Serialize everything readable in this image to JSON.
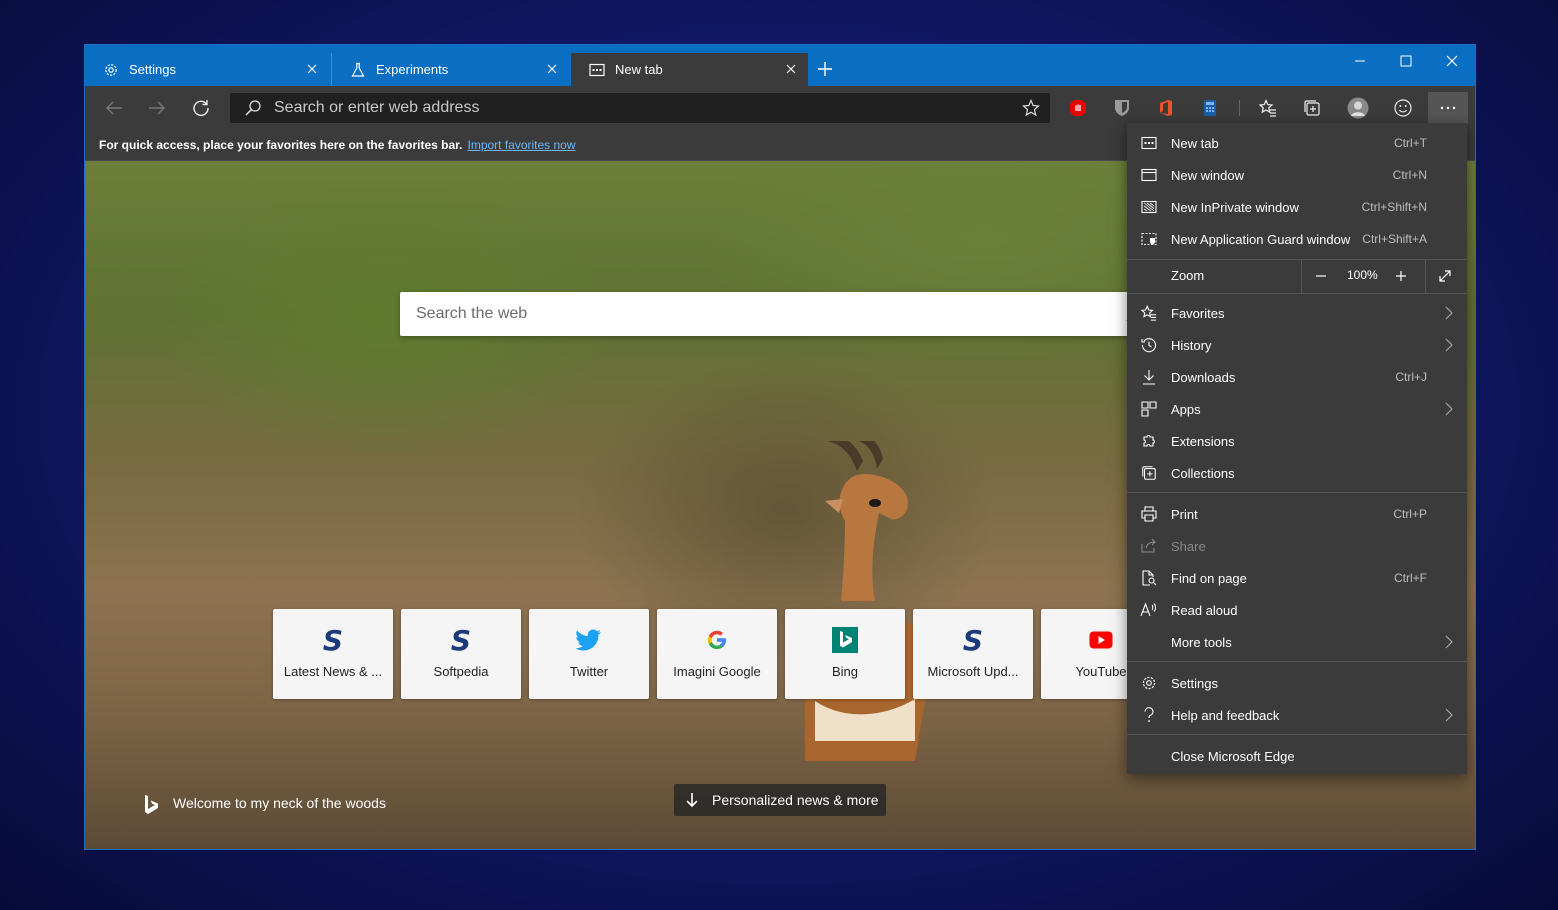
{
  "tabs": [
    {
      "label": "Settings",
      "icon": "gear-icon"
    },
    {
      "label": "Experiments",
      "icon": "flask-icon"
    },
    {
      "label": "New tab",
      "icon": "newtab-icon"
    }
  ],
  "address_bar": {
    "placeholder": "Search or enter web address"
  },
  "favorites_bar": {
    "message": "For quick access, place your favorites here on the favorites bar.",
    "link": "Import favorites now"
  },
  "newtab": {
    "search_placeholder": "Search the web",
    "tiles": [
      {
        "label": "Latest News & ...",
        "logo": "S",
        "color": "#1b3a7a"
      },
      {
        "label": "Softpedia",
        "logo": "S",
        "color": "#1b3a7a"
      },
      {
        "label": "Twitter",
        "logo": "twitter-bird",
        "color": "#1da1f2"
      },
      {
        "label": "Imagini Google",
        "logo": "G",
        "color": "#ea4335"
      },
      {
        "label": "Bing",
        "logo": "b",
        "color": "#008373"
      },
      {
        "label": "Microsoft Upd...",
        "logo": "S",
        "color": "#1b3a7a"
      },
      {
        "label": "YouTube",
        "logo": "play",
        "color": "#ff0000"
      }
    ],
    "welcome": "Welcome to my neck of the woods",
    "news_button": "Personalized news & more"
  },
  "menu": {
    "items_top": [
      {
        "label": "New tab",
        "shortcut": "Ctrl+T"
      },
      {
        "label": "New window",
        "shortcut": "Ctrl+N"
      },
      {
        "label": "New InPrivate window",
        "shortcut": "Ctrl+Shift+N"
      },
      {
        "label": "New Application Guard window",
        "shortcut": "Ctrl+Shift+A"
      }
    ],
    "zoom": {
      "label": "Zoom",
      "value": "100%"
    },
    "items_mid": [
      {
        "label": "Favorites",
        "shortcut": ""
      },
      {
        "label": "History",
        "shortcut": ""
      },
      {
        "label": "Downloads",
        "shortcut": "Ctrl+J"
      },
      {
        "label": "Apps",
        "shortcut": ""
      },
      {
        "label": "Extensions",
        "shortcut": ""
      },
      {
        "label": "Collections",
        "shortcut": ""
      }
    ],
    "items_tools": [
      {
        "label": "Print",
        "shortcut": "Ctrl+P"
      },
      {
        "label": "Share",
        "shortcut": ""
      },
      {
        "label": "Find on page",
        "shortcut": "Ctrl+F"
      },
      {
        "label": "Read aloud",
        "shortcut": ""
      },
      {
        "label": "More tools",
        "shortcut": ""
      }
    ],
    "items_bottom": [
      {
        "label": "Settings",
        "shortcut": ""
      },
      {
        "label": "Help and feedback",
        "shortcut": ""
      }
    ],
    "close": "Close Microsoft Edge"
  },
  "colors": {
    "titlebar": "#0a6fc2",
    "toolbar": "#3b3b3b",
    "link": "#6cb6ff"
  }
}
